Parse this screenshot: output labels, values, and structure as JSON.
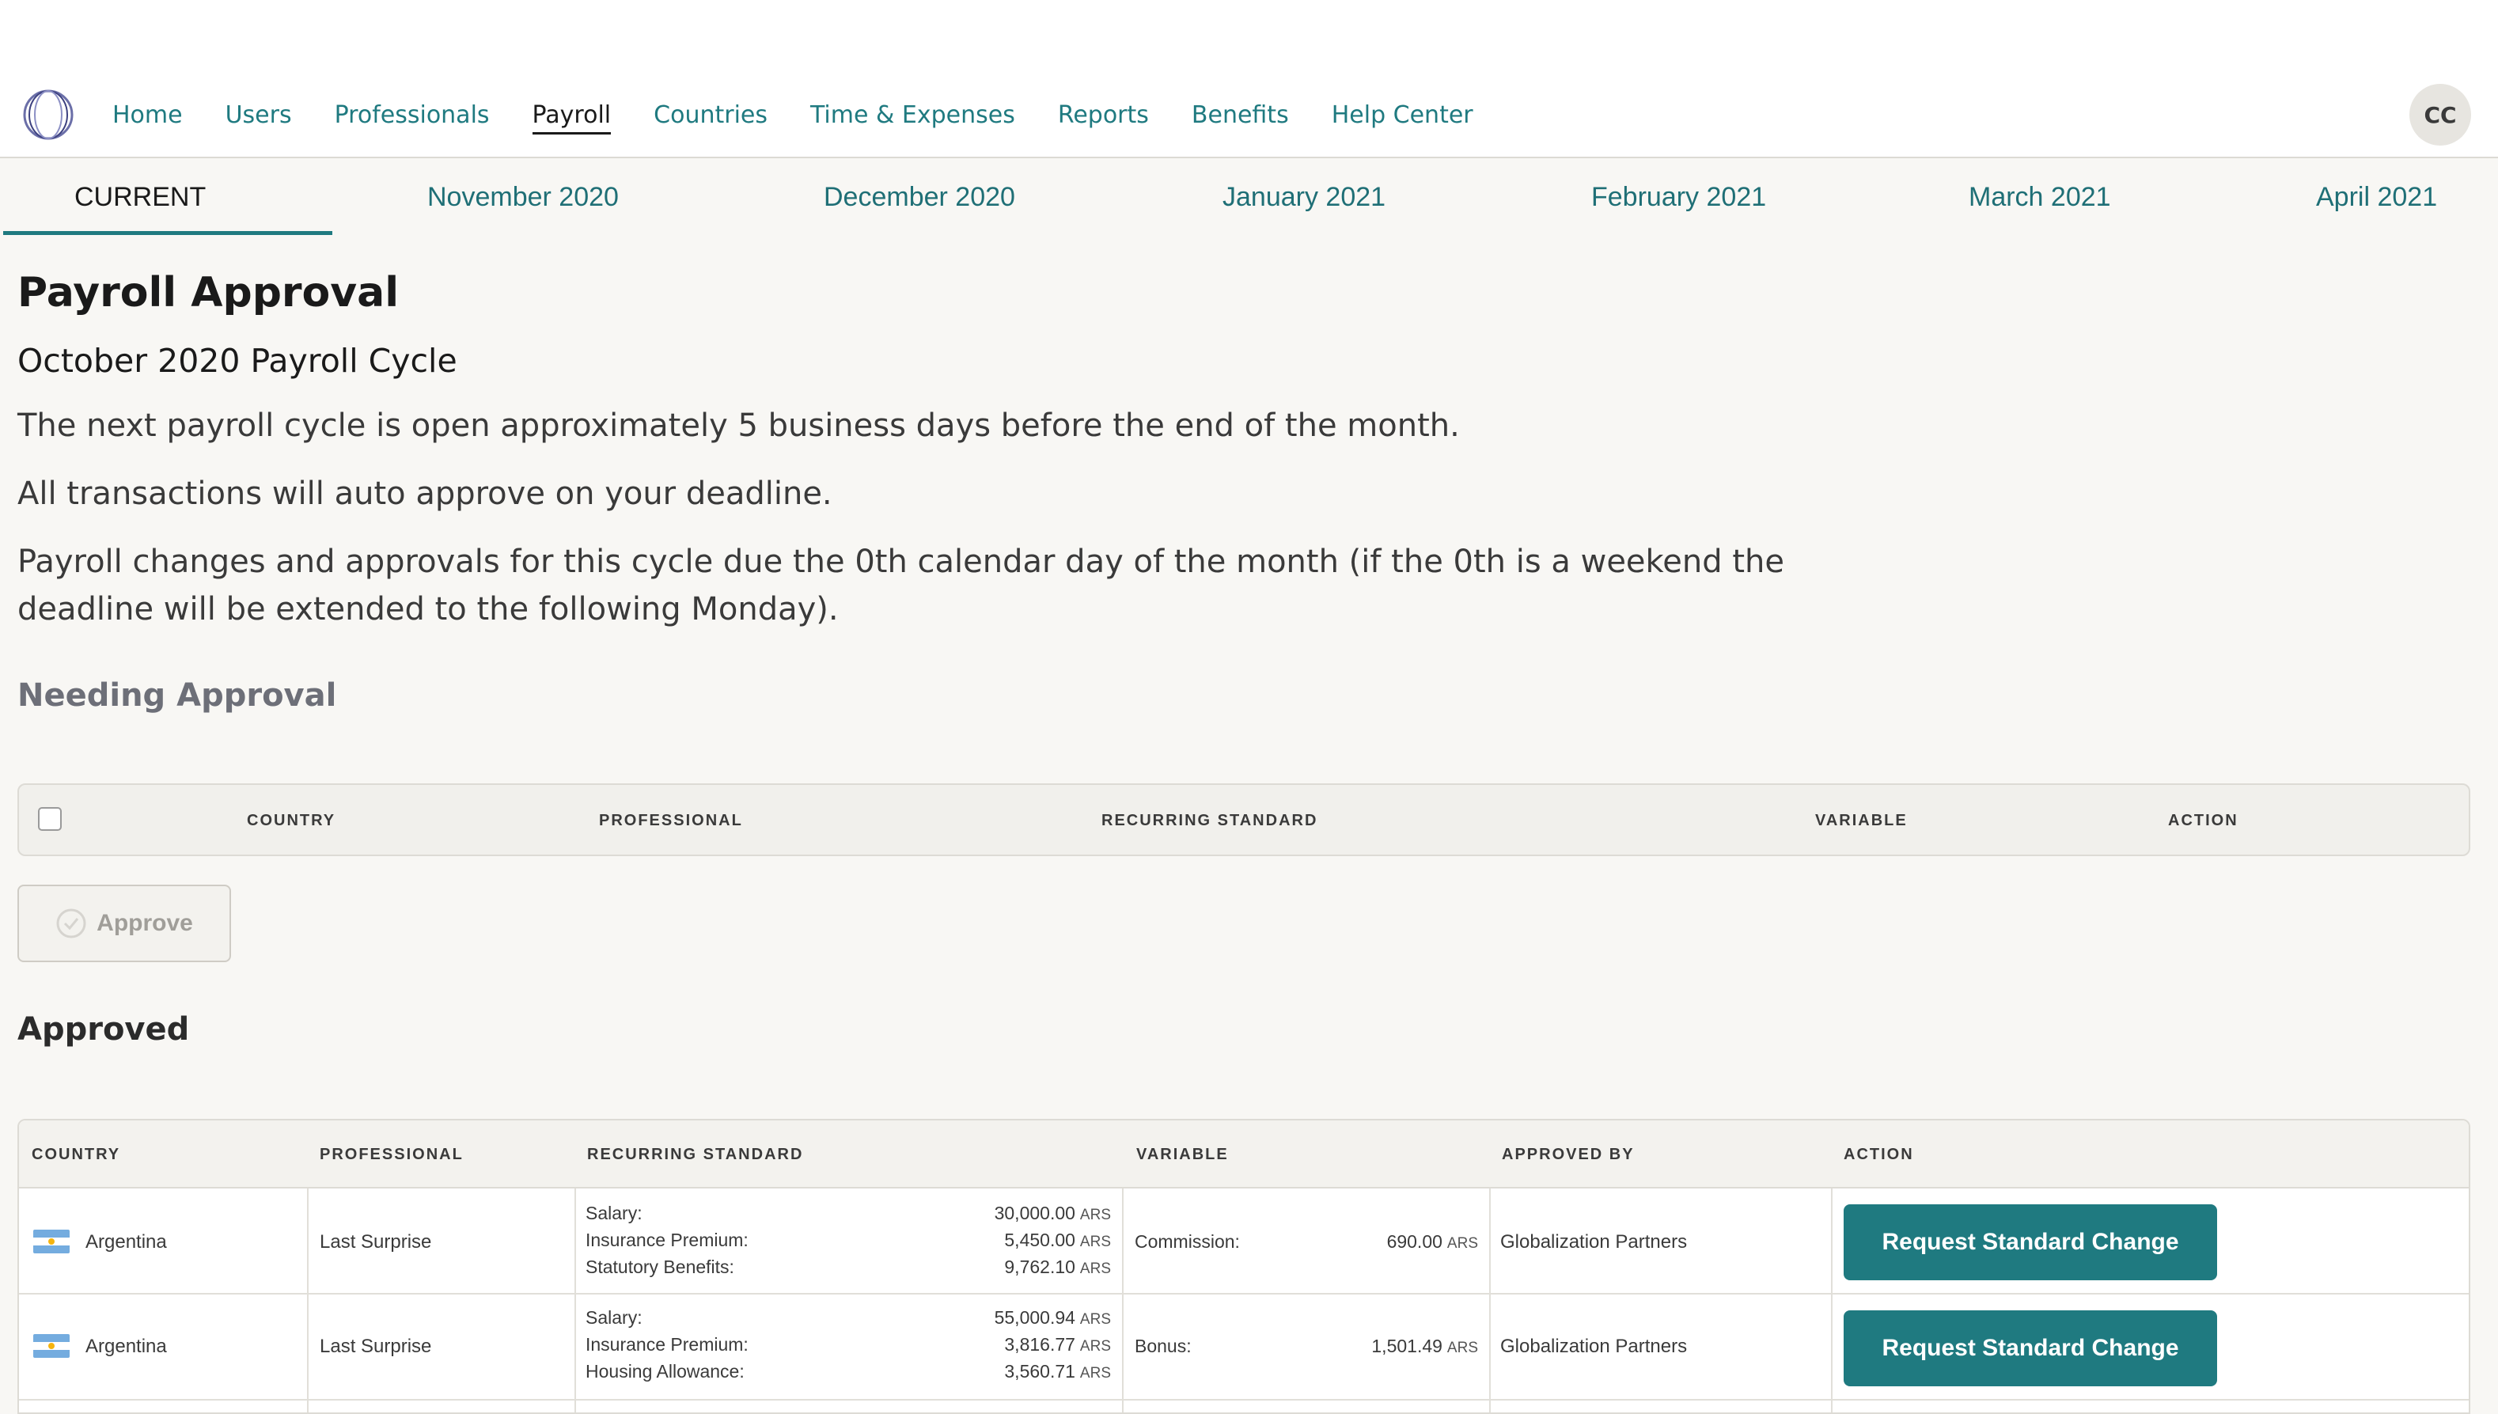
{
  "nav": {
    "items": [
      "Home",
      "Users",
      "Professionals",
      "Payroll",
      "Countries",
      "Time & Expenses",
      "Reports",
      "Benefits",
      "Help Center"
    ],
    "active": "Payroll",
    "avatar_initials": "CC"
  },
  "tabs": [
    "CURRENT",
    "November 2020",
    "December 2020",
    "January 2021",
    "February 2021",
    "March 2021",
    "April 2021"
  ],
  "page": {
    "title": "Payroll Approval",
    "subtitle": "October 2020 Payroll Cycle",
    "line1": "The next payroll cycle is open approximately 5 business days before the end of the month.",
    "line2": "All transactions will auto approve on your deadline.",
    "line3": "Payroll changes and approvals for this cycle due the 0th calendar day of the month (if the 0th is a weekend the deadline will be extended to the following Monday)."
  },
  "needing_approval": {
    "title": "Needing Approval",
    "headers": [
      "COUNTRY",
      "PROFESSIONAL",
      "RECURRING STANDARD",
      "VARIABLE",
      "ACTION"
    ],
    "approve_label": "Approve"
  },
  "approved": {
    "title": "Approved",
    "headers": [
      "COUNTRY",
      "PROFESSIONAL",
      "RECURRING STANDARD",
      "VARIABLE",
      "APPROVED BY",
      "ACTION"
    ],
    "rows": [
      {
        "country": "Argentina",
        "professional": "Last Surprise",
        "recurring": [
          {
            "label": "Salary:",
            "value": "30,000.00",
            "cur": "ARS"
          },
          {
            "label": "Insurance Premium:",
            "value": "5,450.00",
            "cur": "ARS"
          },
          {
            "label": "Statutory Benefits:",
            "value": "9,762.10",
            "cur": "ARS"
          }
        ],
        "variable": {
          "label": "Commission:",
          "value": "690.00",
          "cur": "ARS"
        },
        "approved_by": "Globalization Partners",
        "action": "Request Standard Change"
      },
      {
        "country": "Argentina",
        "professional": "Last Surprise",
        "recurring": [
          {
            "label": "Salary:",
            "value": "55,000.94",
            "cur": "ARS"
          },
          {
            "label": "Insurance Premium:",
            "value": "3,816.77",
            "cur": "ARS"
          },
          {
            "label": "Housing Allowance:",
            "value": "3,560.71",
            "cur": "ARS"
          }
        ],
        "variable": {
          "label": "Bonus:",
          "value": "1,501.49",
          "cur": "ARS"
        },
        "approved_by": "Globalization Partners",
        "action": "Request Standard Change"
      }
    ]
  },
  "colors": {
    "accent": "#1f7a80",
    "background": "#f8f7f4"
  }
}
